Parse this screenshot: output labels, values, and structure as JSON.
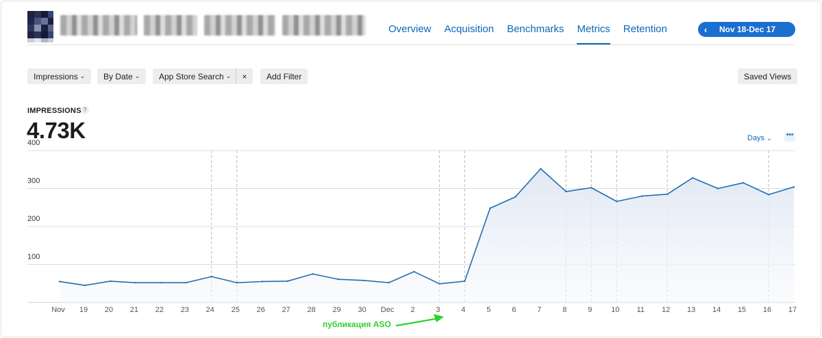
{
  "nav": {
    "tabs": [
      {
        "label": "Overview",
        "active": false
      },
      {
        "label": "Acquisition",
        "active": false
      },
      {
        "label": "Benchmarks",
        "active": false
      },
      {
        "label": "Metrics",
        "active": true
      },
      {
        "label": "Retention",
        "active": false
      }
    ],
    "date_range": "Nov 18-Dec 17",
    "prev_icon": "chevron-left-icon"
  },
  "filters": {
    "metric": "Impressions",
    "grouping": "By Date",
    "source": "App Store Search",
    "remove": "×",
    "add_filter": "Add Filter",
    "saved_views": "Saved Views"
  },
  "metric": {
    "label": "IMPRESSIONS",
    "help": "?",
    "value": "4.73K",
    "period": "Days",
    "more": "•••"
  },
  "colors": {
    "accent": "#0a67b8",
    "date_button": "#1a6fd1",
    "line": "#1f6db2",
    "area": "#e9eef6",
    "annotation": "#2fd12f"
  },
  "annotation": {
    "text": "публикация ASO"
  },
  "chart_data": {
    "type": "area",
    "x": [
      "Nov 18",
      "Nov 19",
      "Nov 20",
      "Nov 21",
      "Nov 22",
      "Nov 23",
      "Nov 24",
      "Nov 25",
      "Nov 26",
      "Nov 27",
      "Nov 28",
      "Nov 29",
      "Nov 30",
      "Dec 1",
      "Dec 2",
      "Dec 3",
      "Dec 4",
      "Dec 5",
      "Dec 6",
      "Dec 7",
      "Dec 8",
      "Dec 9",
      "Dec 10",
      "Dec 11",
      "Dec 12",
      "Dec 13",
      "Dec 14",
      "Dec 15",
      "Dec 16",
      "Dec 17"
    ],
    "tick_labels": [
      "Nov",
      "19",
      "20",
      "21",
      "22",
      "23",
      "24",
      "25",
      "26",
      "27",
      "28",
      "29",
      "30",
      "Dec",
      "2",
      "3",
      "4",
      "5",
      "6",
      "7",
      "8",
      "9",
      "10",
      "11",
      "12",
      "13",
      "14",
      "15",
      "16",
      "17"
    ],
    "series": [
      {
        "values": [
          55,
          45,
          56,
          52,
          52,
          52,
          68,
          52,
          55,
          56,
          75,
          61,
          58,
          52,
          81,
          49,
          56,
          248,
          278,
          352,
          292,
          302,
          266,
          280,
          285,
          328,
          300,
          315,
          284,
          304
        ]
      }
    ],
    "ylim": [
      0,
      400
    ],
    "yticks": [
      100,
      200,
      300,
      400
    ],
    "dashed_x_indices": [
      6,
      7,
      15,
      16,
      20,
      21,
      22,
      24,
      28
    ],
    "grid": true,
    "title": "",
    "xlabel": "",
    "ylabel": ""
  }
}
